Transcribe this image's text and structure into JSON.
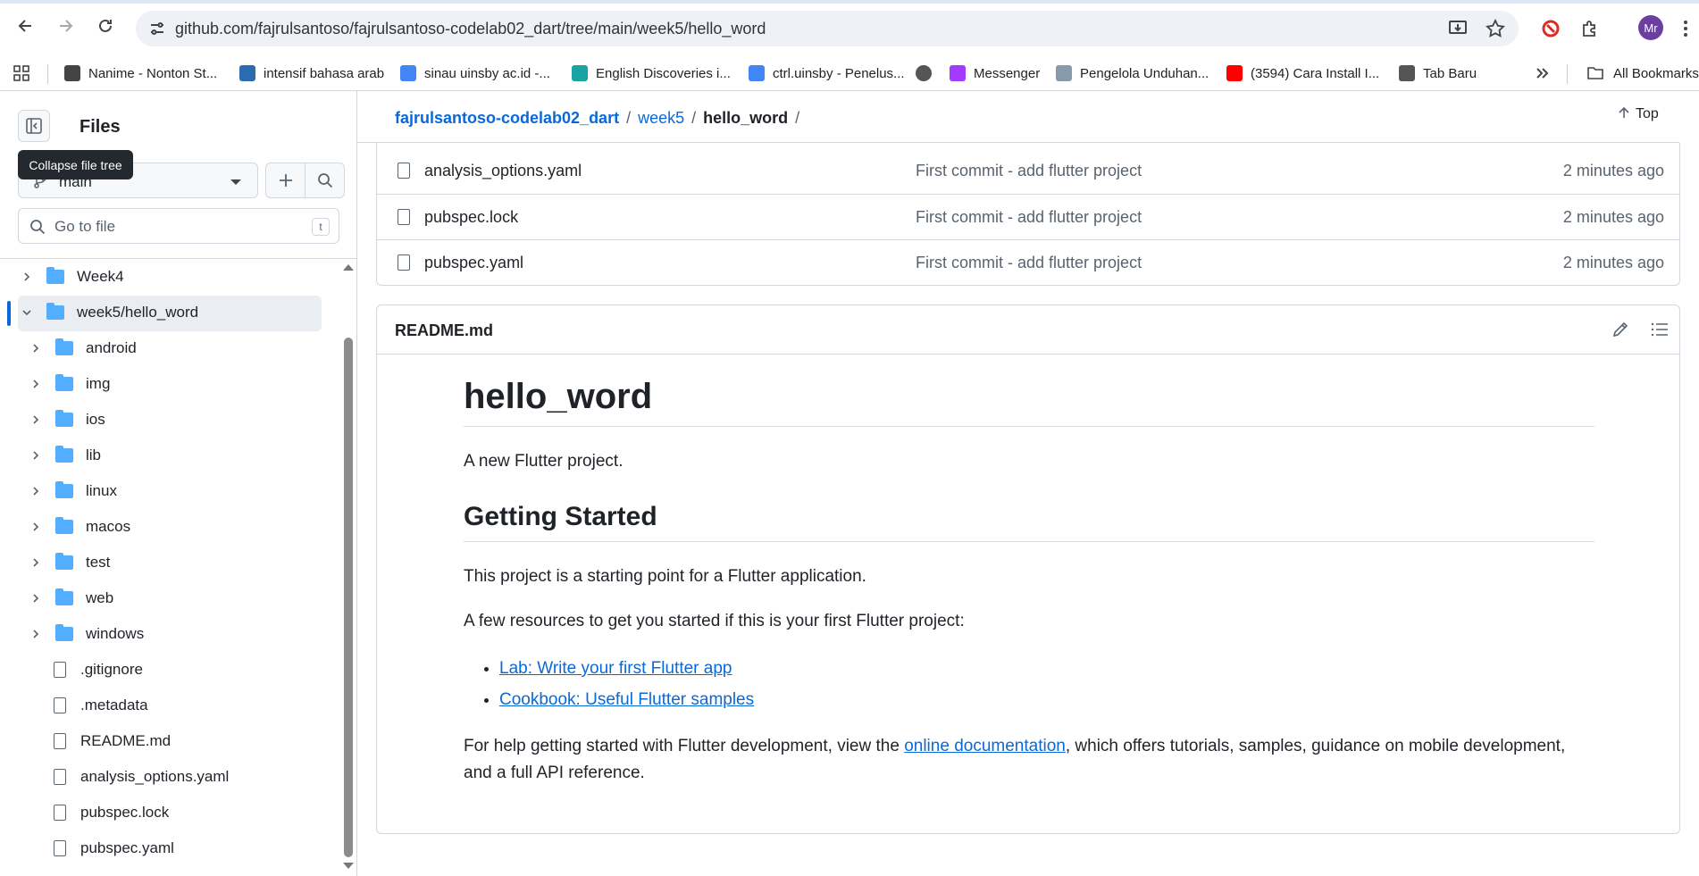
{
  "browser": {
    "url": "github.com/fajrulsantoso/fajrulsantoso-codelab02_dart/tree/main/week5/hello_word",
    "avatar_initials": "Mr"
  },
  "bookmarks": [
    {
      "label": "Nanime - Nonton St...",
      "color": "#444"
    },
    {
      "label": "intensif bahasa arab",
      "color": "#2b6cb0"
    },
    {
      "label": "sinau uinsby ac.id -...",
      "color": "#4285f4"
    },
    {
      "label": "English Discoveries i...",
      "color": "#1aa3a3"
    },
    {
      "label": "ctrl.uinsby - Penelus...",
      "color": "#4285f4"
    },
    {
      "label": "",
      "color": "#555"
    },
    {
      "label": "Messenger",
      "color": "#a33bff"
    },
    {
      "label": "Pengelola Unduhan...",
      "color": "#8899aa"
    },
    {
      "label": "(3594) Cara Install I...",
      "color": "#ff0000"
    },
    {
      "label": "Tab Baru",
      "color": "#555"
    }
  ],
  "bookmarks_all": "All Bookmarks",
  "sidebar": {
    "title": "Files",
    "tooltip": "Collapse file tree",
    "branch": "main",
    "goto_placeholder": "Go to file",
    "goto_key": "t",
    "tree": [
      {
        "label": "Week4",
        "type": "folder",
        "level": 0,
        "expanded": false
      },
      {
        "label": "week5/hello_word",
        "type": "folder",
        "level": 0,
        "expanded": true,
        "selected": true
      },
      {
        "label": "android",
        "type": "folder",
        "level": 1
      },
      {
        "label": "img",
        "type": "folder",
        "level": 1
      },
      {
        "label": "ios",
        "type": "folder",
        "level": 1
      },
      {
        "label": "lib",
        "type": "folder",
        "level": 1
      },
      {
        "label": "linux",
        "type": "folder",
        "level": 1
      },
      {
        "label": "macos",
        "type": "folder",
        "level": 1
      },
      {
        "label": "test",
        "type": "folder",
        "level": 1
      },
      {
        "label": "web",
        "type": "folder",
        "level": 1
      },
      {
        "label": "windows",
        "type": "folder",
        "level": 1
      },
      {
        "label": ".gitignore",
        "type": "file",
        "level": 1
      },
      {
        "label": ".metadata",
        "type": "file",
        "level": 1
      },
      {
        "label": "README.md",
        "type": "file",
        "level": 1
      },
      {
        "label": "analysis_options.yaml",
        "type": "file",
        "level": 1
      },
      {
        "label": "pubspec.lock",
        "type": "file",
        "level": 1
      },
      {
        "label": "pubspec.yaml",
        "type": "file",
        "level": 1
      }
    ]
  },
  "breadcrumb": {
    "repo": "fajrulsantoso-codelab02_dart",
    "sep": "/",
    "dir": "week5",
    "current": "hello_word",
    "top_label": "Top"
  },
  "files": [
    {
      "name": "analysis_options.yaml",
      "commit": "First commit - add flutter project",
      "time": "2 minutes ago"
    },
    {
      "name": "pubspec.lock",
      "commit": "First commit - add flutter project",
      "time": "2 minutes ago"
    },
    {
      "name": "pubspec.yaml",
      "commit": "First commit - add flutter project",
      "time": "2 minutes ago"
    }
  ],
  "readme": {
    "filename": "README.md",
    "h1": "hello_word",
    "intro": "A new Flutter project.",
    "h2": "Getting Started",
    "p1": "This project is a starting point for a Flutter application.",
    "p2": "A few resources to get you started if this is your first Flutter project:",
    "links": [
      "Lab: Write your first Flutter app",
      "Cookbook: Useful Flutter samples"
    ],
    "p3_before": "For help getting started with Flutter development, view the ",
    "p3_link": "online documentation",
    "p3_after": ", which offers tutorials, samples, guidance on mobile development, and a full API reference."
  }
}
